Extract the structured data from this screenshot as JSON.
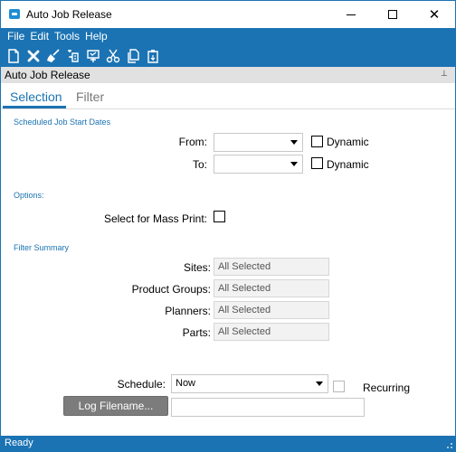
{
  "window": {
    "title": "Auto Job Release",
    "buttons": {
      "minimize": "minimize",
      "maximize": "maximize",
      "close": "close"
    }
  },
  "menu": {
    "items": [
      "File",
      "Edit",
      "Tools",
      "Help"
    ]
  },
  "toolbar": {
    "icons": [
      "new-icon",
      "delete-icon",
      "clear-icon",
      "refresh-icon",
      "print-icon",
      "cut-icon",
      "copy-icon",
      "paste-icon"
    ]
  },
  "panel": {
    "title": "Auto Job Release",
    "pin_icon": "pin-icon"
  },
  "tabs": {
    "selection": "Selection",
    "filter": "Filter",
    "active": "Selection",
    "accent": "#1b73b3"
  },
  "scheduled": {
    "section_title": "Scheduled Job Start Dates",
    "from_label": "From:",
    "from_value": "",
    "to_label": "To:",
    "to_value": "",
    "dynamic_label_from": "Dynamic",
    "dynamic_label_to": "Dynamic",
    "dynamic_from_checked": false,
    "dynamic_to_checked": false
  },
  "options": {
    "section_title": "Options:",
    "mass_print_label": "Select for Mass Print:",
    "mass_print_checked": false
  },
  "filter_summary": {
    "section_title": "Filter Summary",
    "rows": [
      {
        "label": "Sites:",
        "value": "All Selected"
      },
      {
        "label": "Product Groups:",
        "value": "All Selected"
      },
      {
        "label": "Planners:",
        "value": "All Selected"
      },
      {
        "label": "Parts:",
        "value": "All Selected"
      }
    ]
  },
  "schedule": {
    "label": "Schedule:",
    "value": "Now",
    "recurring_label": "Recurring",
    "recurring_checked": false
  },
  "log": {
    "button_label": "Log Filename...",
    "value": ""
  },
  "status": {
    "text": "Ready"
  }
}
